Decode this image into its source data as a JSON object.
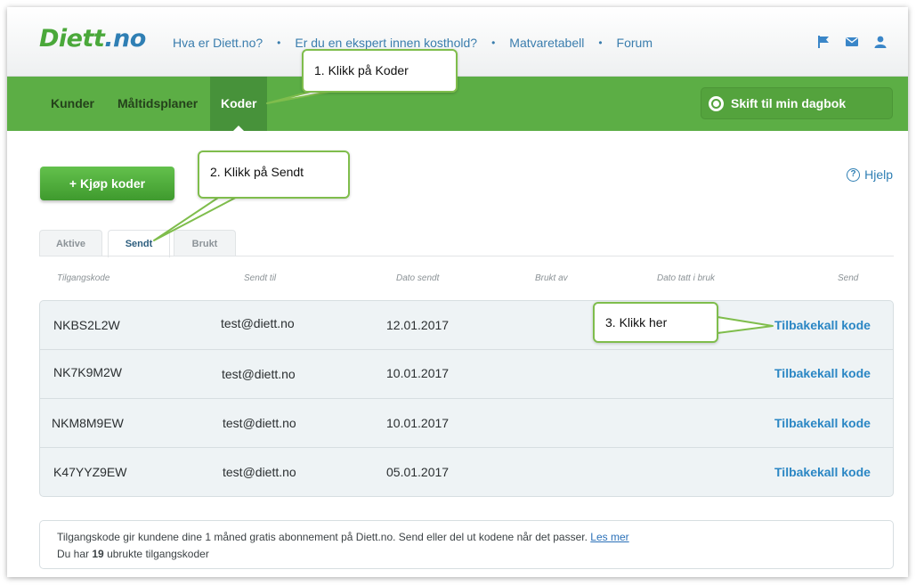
{
  "logo": {
    "main": "Diett",
    "suffix": ".no"
  },
  "top_nav": {
    "items": [
      "Hva er Diett.no?",
      "Er du en ekspert innen kosthold?",
      "Matvaretabell",
      "Forum"
    ],
    "separator": "•",
    "icons": [
      "flag-icon",
      "mail-icon",
      "user-icon"
    ]
  },
  "main_nav": {
    "items": [
      "Kunder",
      "Måltidsplaner",
      "Koder"
    ],
    "active": "Koder",
    "diary_button": "Skift til min dagbok"
  },
  "toolbar": {
    "buy_button": "+ Kjøp koder",
    "help_label": "Hjelp",
    "help_glyph": "?"
  },
  "tabs": {
    "items": [
      "Aktive",
      "Sendt",
      "Brukt"
    ],
    "active": "Sendt"
  },
  "table": {
    "columns": [
      "Tilgangskode",
      "Sendt til",
      "Dato sendt",
      "Brukt av",
      "Dato tatt i bruk",
      "Send"
    ],
    "rows": [
      {
        "code": "NKBS2L2W",
        "sent_to": "test@diett.no",
        "date_sent": "12.01.2017",
        "used_by": "",
        "date_used": "",
        "action": "Tilbakekall kode"
      },
      {
        "code": "NK7K9M2W",
        "sent_to": "test@diett.no",
        "date_sent": "10.01.2017",
        "used_by": "",
        "date_used": "",
        "action": "Tilbakekall kode"
      },
      {
        "code": "NKM8M9EW",
        "sent_to": "test@diett.no",
        "date_sent": "10.01.2017",
        "used_by": "",
        "date_used": "",
        "action": "Tilbakekall kode"
      },
      {
        "code": "K47YYZ9EW",
        "sent_to": "test@diett.no",
        "date_sent": "05.01.2017",
        "used_by": "",
        "date_used": "",
        "action": "Tilbakekall kode"
      }
    ]
  },
  "info": {
    "line1": "Tilgangskode gir kundene dine 1 måned gratis abonnement på Diett.no. Send eller del ut kodene når det passer.",
    "link": "Les mer",
    "line2_prefix": "Du har",
    "count": "19",
    "line2_suffix": "ubrukte tilgangskoder"
  },
  "callouts": [
    "1. Klikk på Koder",
    "2. Klikk på Sendt",
    "3. Klikk her"
  ],
  "colors": {
    "brand_green": "#5cae45",
    "active_tab": "#47923a",
    "link_blue": "#2a86c4",
    "callout_border": "#7fbd4c"
  }
}
